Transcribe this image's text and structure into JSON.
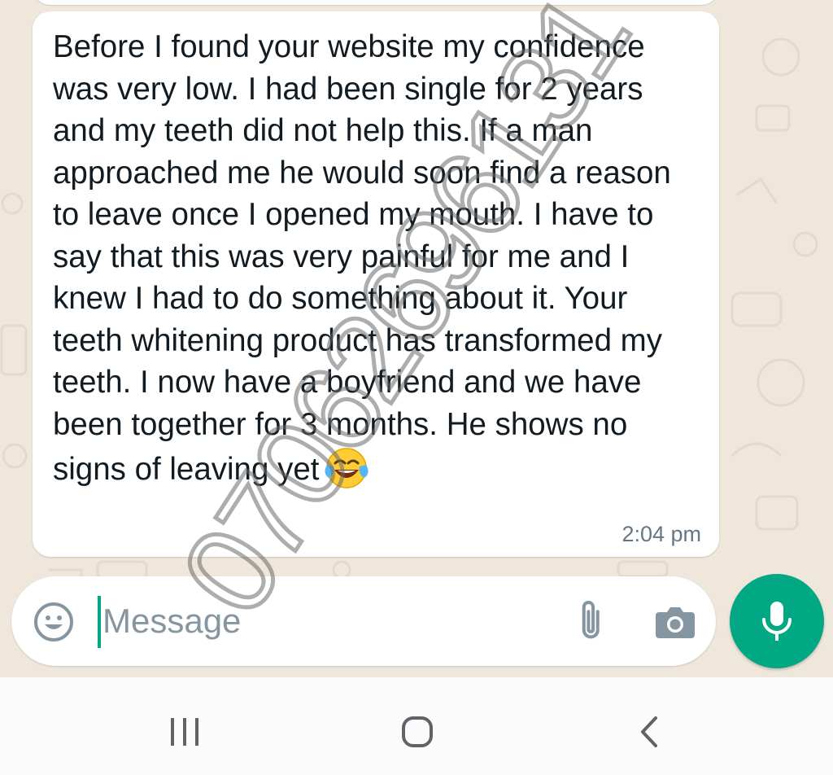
{
  "chat": {
    "message": {
      "text": "Before I found your website my confidence was very low. I had been single for 2 years and my teeth did not help this. If a man approached me he would soon find a reason to leave once I opened my mouth. I have to say that this was very painful for me and I knew I had to do something about it. Your teeth whitening product has transformed my teeth. I now have a boyfriend and we have been together for 3 months. He shows no signs of leaving yet",
      "emoji": "face-with-tears-of-joy",
      "time": "2:04 pm"
    },
    "bubble_color": "#ffffff",
    "wallpaper_color": "#efe7dc"
  },
  "composer": {
    "placeholder": "Message",
    "value": "",
    "icons": [
      "smiley-icon",
      "paperclip-icon",
      "camera-icon"
    ],
    "mic_icon": "microphone-icon",
    "accent_color": "#00a884"
  },
  "navigation": {
    "icons": [
      "recent-apps-icon",
      "home-icon",
      "back-icon"
    ]
  },
  "watermark": {
    "text": "07062696131"
  }
}
